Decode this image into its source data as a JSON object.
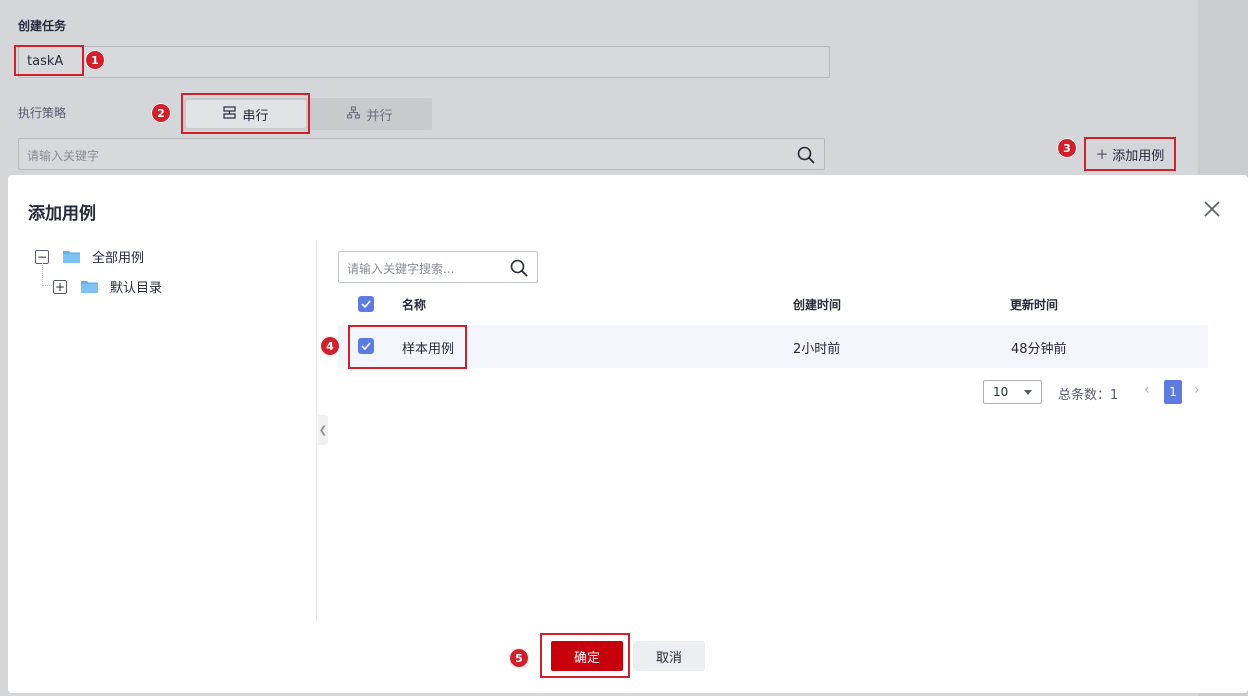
{
  "background": {
    "title": "创建任务",
    "task_name_value": "taskA",
    "strategy_label": "执行策略",
    "strategy_options": [
      {
        "label": "串行",
        "icon": "serial-icon",
        "selected": true
      },
      {
        "label": "并行",
        "icon": "parallel-icon",
        "selected": false
      }
    ],
    "search_placeholder": "请输入关键字",
    "add_case_label": "添加用例"
  },
  "modal": {
    "title": "添加用例",
    "tree": [
      {
        "label": "全部用例",
        "toggle": "−",
        "expanded": true
      },
      {
        "label": "默认目录",
        "toggle": "+",
        "expanded": false
      }
    ],
    "search_placeholder": "请输入关键字搜索...",
    "table": {
      "columns": [
        "名称",
        "创建时间",
        "更新时间"
      ],
      "rows": [
        {
          "name": "样本用例",
          "created": "2小时前",
          "updated": "48分钟前",
          "checked": true
        }
      ]
    },
    "pagination": {
      "page_size": "10",
      "total_label": "总条数：1",
      "current_page": "1"
    },
    "confirm_label": "确定",
    "cancel_label": "取消"
  },
  "annotations": [
    "1",
    "2",
    "3",
    "4",
    "5"
  ],
  "colors": {
    "primary": "#c7000b",
    "accent": "#5e7ce0",
    "annotation": "#d0202b"
  }
}
